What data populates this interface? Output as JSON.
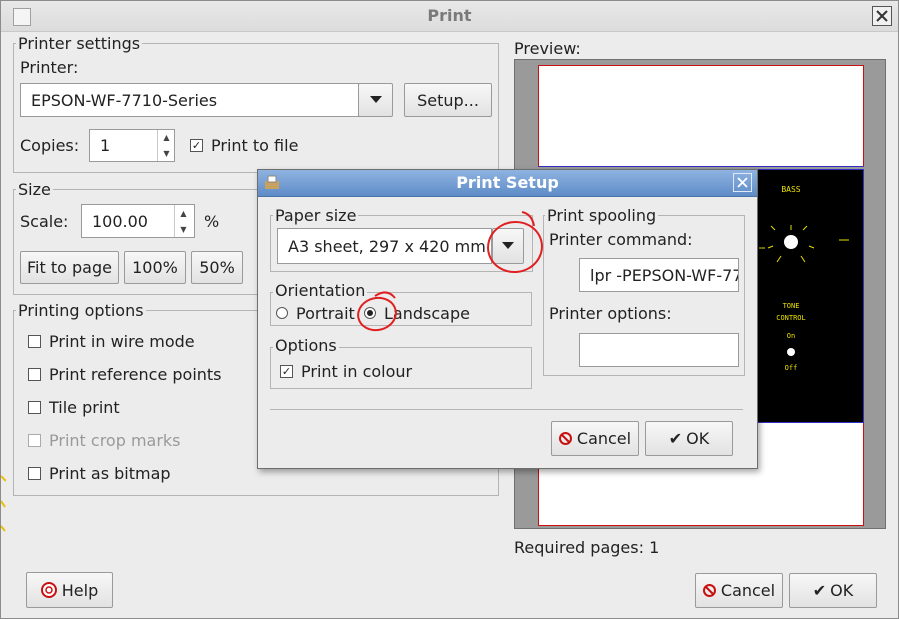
{
  "main_window": {
    "title": "Print",
    "printer_settings": {
      "group_label": "Printer settings",
      "printer_label": "Printer:",
      "printer_value": "EPSON-WF-7710-Series",
      "setup_button": "Setup...",
      "copies_label": "Copies:",
      "copies_value": "1",
      "print_to_file": {
        "label": "Print to file",
        "checked": true
      }
    },
    "size": {
      "group_label": "Size",
      "scale_label": "Scale:",
      "scale_value": "100.00",
      "scale_unit": "%",
      "buttons": [
        "Fit to page",
        "100%",
        "50%"
      ]
    },
    "printing_options": {
      "group_label": "Printing options",
      "items": [
        {
          "label": "Print in wire mode",
          "checked": false,
          "enabled": true
        },
        {
          "label": "Print reference points",
          "checked": false,
          "enabled": true
        },
        {
          "label": "Tile print",
          "checked": false,
          "enabled": true
        },
        {
          "label": "Print crop marks",
          "checked": false,
          "enabled": false
        },
        {
          "label": "Print as bitmap",
          "checked": false,
          "enabled": true
        }
      ]
    },
    "preview": {
      "label": "Preview:",
      "required_pages_label": "Required pages: 1",
      "content": {
        "bass": "BASS",
        "tone_control": "TONE",
        "control": "CONTROL",
        "on": "On",
        "off": "Off"
      }
    },
    "help_button": "Help",
    "cancel_button": "Cancel",
    "ok_button": "OK"
  },
  "print_setup_dialog": {
    "title": "Print Setup",
    "paper_size": {
      "group_label": "Paper size",
      "value": "A3 sheet, 297 x 420 mm"
    },
    "orientation": {
      "group_label": "Orientation",
      "portrait": "Portrait",
      "landscape": "Landscape",
      "selected": "landscape"
    },
    "options": {
      "group_label": "Options",
      "print_in_colour": {
        "label": "Print in colour",
        "checked": true
      }
    },
    "print_spooling": {
      "group_label": "Print spooling",
      "printer_command_label": "Printer command:",
      "printer_command_value": "lpr -PEPSON-WF-77",
      "printer_options_label": "Printer options:",
      "printer_options_value": ""
    },
    "cancel_button": "Cancel",
    "ok_button": "OK"
  },
  "colors": {
    "dialog_title_bar": "#6f98d0",
    "annotation_red": "#e02020",
    "cancel_icon_red": "#c81010",
    "preview_pcb_text": "#e8e000"
  }
}
